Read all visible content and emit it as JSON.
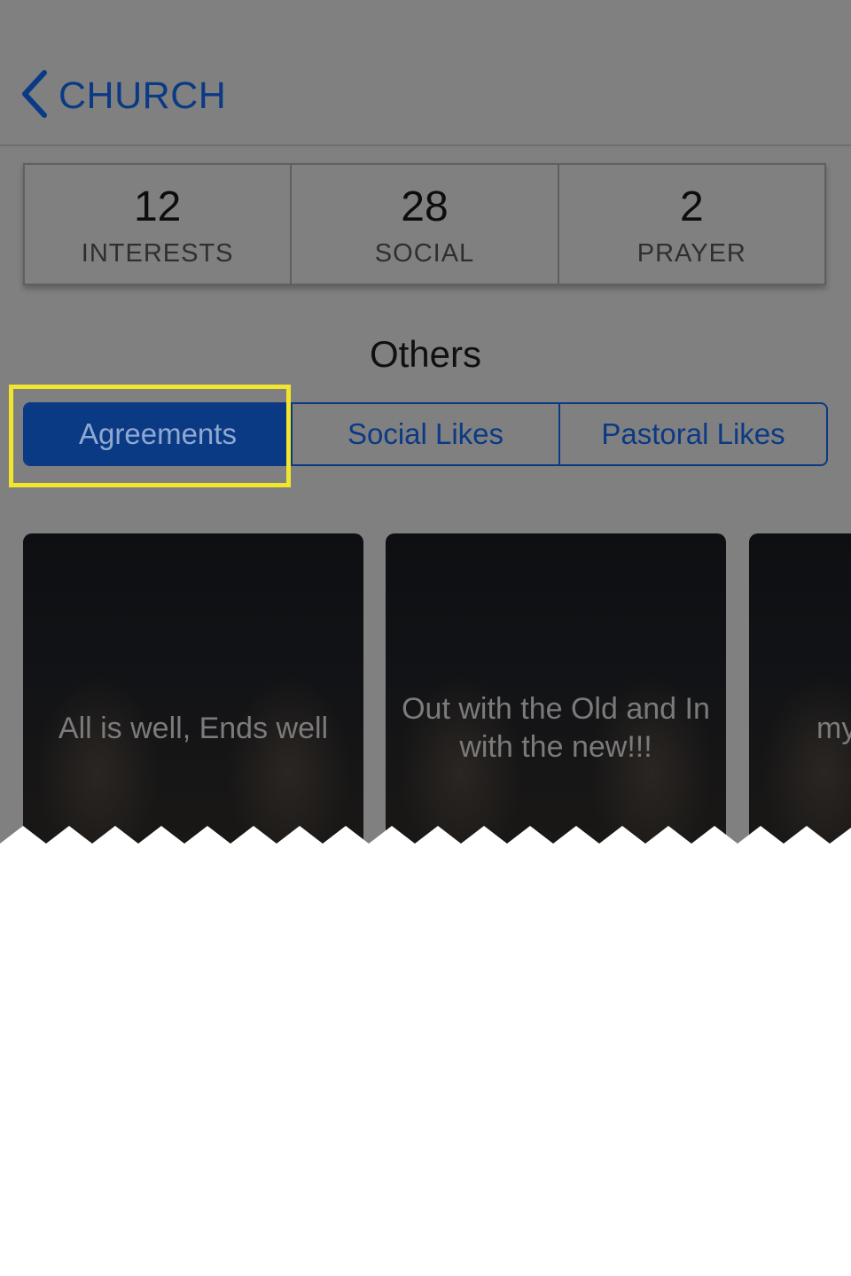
{
  "nav": {
    "back_label": "CHURCH",
    "back_icon": "chevron-left-icon",
    "accent_color": "#0b3a85"
  },
  "stats": [
    {
      "number": "12",
      "label": "INTERESTS"
    },
    {
      "number": "28",
      "label": "SOCIAL"
    },
    {
      "number": "2",
      "label": "PRAYER"
    }
  ],
  "section_title": "Others",
  "segments": {
    "items": [
      "Agreements",
      "Social Likes",
      "Pastoral Likes"
    ],
    "selected": "Agreements"
  },
  "highlight_color": "#f2e62c",
  "cards": [
    {
      "text": "All is well, Ends well"
    },
    {
      "text": "Out with the Old and In with the new!!!"
    },
    {
      "text": "my"
    }
  ]
}
